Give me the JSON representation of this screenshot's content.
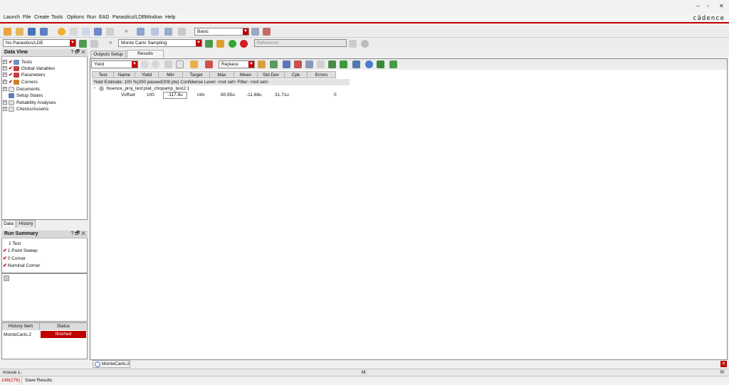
{
  "menubar": {
    "items": [
      "Launch",
      "File",
      "Create",
      "Tools",
      "Options",
      "Run",
      "EAD",
      "Parasitics/LDE",
      "Window",
      "Help"
    ]
  },
  "window_controls": [
    "–",
    "▫",
    "✕"
  ],
  "brand": "cādence",
  "toolbar1": {
    "mode_value": "Basic"
  },
  "toolbar2": {
    "parasitics_value": "No Parasitics/LDE",
    "run_mode_value": "Monte Carlo Sampling",
    "reference_label": "Reference:"
  },
  "data_view": {
    "title": "Data View",
    "controls": "? 🗗 ✕",
    "items": [
      {
        "label": "Tests",
        "checked": true,
        "expander": "+"
      },
      {
        "label": "Global Variables",
        "checked": true,
        "expander": "+"
      },
      {
        "label": "Parameters",
        "checked": true,
        "expander": "+"
      },
      {
        "label": "Corners",
        "checked": true,
        "expander": "+"
      },
      {
        "label": "Documents",
        "checked": false,
        "expander": "+"
      },
      {
        "label": "Setup States",
        "checked": false,
        "expander": ""
      },
      {
        "label": "Reliability Analyses",
        "checked": false,
        "expander": "+"
      },
      {
        "label": "Checks/Asserts",
        "checked": false,
        "expander": "+"
      }
    ],
    "tabs": [
      "Data",
      "History"
    ]
  },
  "run_summary": {
    "title": "Run Summary",
    "controls": "? 🗗 ✕",
    "items": [
      {
        "label": "1 Test",
        "checked": false
      },
      {
        "label": "1 Point Sweep",
        "checked": true
      },
      {
        "label": "0 Corner",
        "checked": true
      },
      {
        "label": "Nominal Corner",
        "checked": true
      }
    ]
  },
  "history_table": {
    "headers": [
      "History Item",
      "Status"
    ],
    "rows": [
      {
        "item": "MonteCarlo.2",
        "status": "finished"
      }
    ]
  },
  "main_tabs": [
    "Outputs Setup",
    "Results"
  ],
  "results_toolbar": {
    "view_value": "Yield",
    "replace_value": "Replace"
  },
  "results": {
    "headers": [
      "Test",
      "Name",
      "Yield",
      "Min",
      "Target",
      "Max",
      "Mean",
      "Std Dev",
      "Cpk",
      "Errors"
    ],
    "estimate_line": "Yield Estimate: 100 %(200 passed/200 pts)   Confidence Level: <not set>   Filter: <not set>",
    "test_name": "hisence_proj_test:plat_chopamp_test2:1",
    "rows": [
      {
        "test": "",
        "name": "Voffset",
        "yield": "100",
        "min": "-117.8u",
        "target": "info",
        "max": "80.95u",
        "mean": "-11.68u",
        "std_dev": "31.71u",
        "cpk": "",
        "errors": "0"
      }
    ]
  },
  "bottom_tab": "MonteCarlo.2",
  "status": {
    "mouse": "mouse L:",
    "mid": "M:",
    "right": "R:",
    "count": "148(276)",
    "message": "Save Results"
  },
  "colors": {
    "accent": "#c00000",
    "finished_bg": "#c00000"
  }
}
